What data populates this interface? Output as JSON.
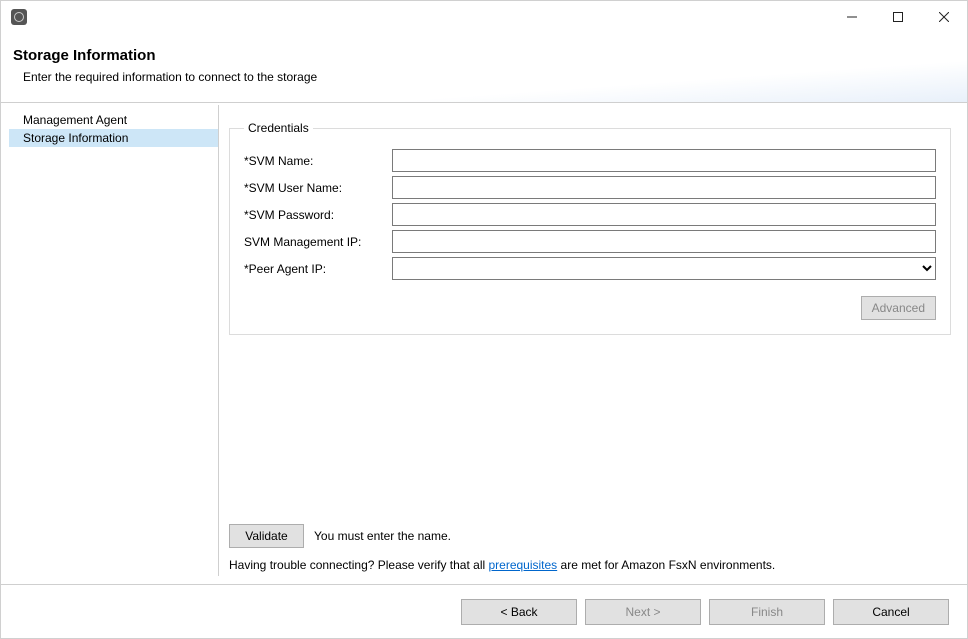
{
  "window": {
    "title": ""
  },
  "header": {
    "title": "Storage Information",
    "subtitle": "Enter the required information to connect to the storage"
  },
  "sidebar": {
    "items": [
      {
        "label": "Management Agent",
        "selected": false
      },
      {
        "label": "Storage Information",
        "selected": true
      }
    ]
  },
  "credentials": {
    "legend": "Credentials",
    "fields": {
      "svm_name": {
        "label": "*SVM Name:",
        "value": ""
      },
      "svm_user": {
        "label": "*SVM User Name:",
        "value": ""
      },
      "svm_password": {
        "label": "*SVM Password:",
        "value": ""
      },
      "svm_mgmt_ip": {
        "label": "SVM Management IP:",
        "value": ""
      },
      "peer_agent_ip": {
        "label": "*Peer Agent IP:",
        "value": ""
      }
    },
    "advanced_label": "Advanced"
  },
  "validate": {
    "button_label": "Validate",
    "message": "You must enter the name."
  },
  "trouble": {
    "prefix": "Having trouble connecting? Please verify that all ",
    "link": "prerequisites",
    "suffix": " are met for Amazon FsxN environments."
  },
  "footer": {
    "back": "< Back",
    "next": "Next >",
    "finish": "Finish",
    "cancel": "Cancel"
  }
}
